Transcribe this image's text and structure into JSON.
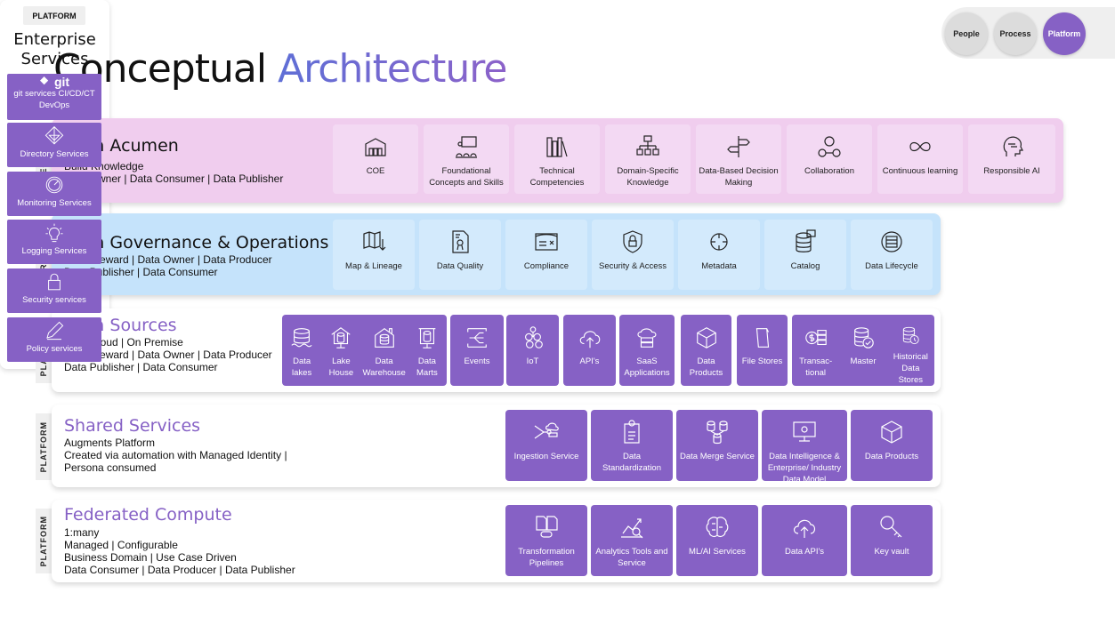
{
  "title": {
    "part1": "Conceptual",
    "part2": "Architecture"
  },
  "toggle": [
    {
      "label": "People",
      "active": false
    },
    {
      "label": "Process",
      "active": false
    },
    {
      "label": "Platform",
      "active": true
    }
  ],
  "colors": {
    "accent": "#8661c5",
    "people_band": "#f0cdee",
    "people_tile": "#f3d9f3",
    "process_band": "#c5e3fb",
    "process_tile": "#d3eafc"
  },
  "rows": [
    {
      "side": "PEOPLE",
      "title": "Data Acumen",
      "sub": [
        "Build Knowledge",
        "Data Owner | Data Consumer | Data Publisher"
      ],
      "tiles": [
        {
          "label": "COE",
          "icon": "building-icon"
        },
        {
          "label": "Foundational Concepts and Skills",
          "icon": "classroom-icon"
        },
        {
          "label": "Technical Competencies",
          "icon": "books-icon"
        },
        {
          "label": "Domain-Specific Knowledge",
          "icon": "hierarchy-icon"
        },
        {
          "label": "Data-Based Decision Making",
          "icon": "signpost-icon"
        },
        {
          "label": "Collaboration",
          "icon": "people-network-icon"
        },
        {
          "label": "Continuous learning",
          "icon": "infinity-icon"
        },
        {
          "label": "Responsible AI",
          "icon": "head-brain-icon"
        }
      ]
    },
    {
      "side": "PROCESS",
      "title": "Data Governance & Operations",
      "sub": [
        "Data Steward | Data Owner | Data Producer",
        "Data Publisher | Data Consumer"
      ],
      "tiles": [
        {
          "label": "Map & Lineage",
          "icon": "map-icon"
        },
        {
          "label": "Data Quality",
          "icon": "certificate-icon"
        },
        {
          "label": "Compliance",
          "icon": "compliance-icon"
        },
        {
          "label": "Security & Access",
          "icon": "shield-lock-icon"
        },
        {
          "label": "Metadata",
          "icon": "metadata-icon"
        },
        {
          "label": "Catalog",
          "icon": "catalog-icon"
        },
        {
          "label": "Data Lifecycle",
          "icon": "lifecycle-icon"
        }
      ]
    },
    {
      "side": "PLATFORM",
      "title": "Data Sources",
      "sub": [
        "Multi-Cloud | On Premise",
        "Data Steward | Data Owner | Data Producer",
        "Data Publisher | Data Consumer"
      ],
      "groups": [
        [
          {
            "label": "Data lakes",
            "icon": "database-lake-icon"
          },
          {
            "label": "Lake House",
            "icon": "database-house-icon"
          },
          {
            "label": "Data Warehouse",
            "icon": "warehouse-icon"
          },
          {
            "label": "Data Marts",
            "icon": "data-mart-icon"
          }
        ],
        [
          {
            "label": "Events",
            "icon": "events-icon"
          }
        ],
        [
          {
            "label": "IoT",
            "icon": "iot-icon"
          }
        ],
        [
          {
            "label": "API's",
            "icon": "cloud-upload-icon"
          }
        ],
        [
          {
            "label": "SaaS Applications",
            "icon": "saas-icon"
          }
        ],
        [
          {
            "label": "Data Products",
            "icon": "cube-icon"
          }
        ],
        [
          {
            "label": "File Stores",
            "icon": "file-icon"
          }
        ],
        [
          {
            "label": "Transac-tional",
            "icon": "transaction-icon"
          },
          {
            "label": "Master",
            "icon": "database-check-icon"
          },
          {
            "label": "Historical Data Stores",
            "icon": "database-clock-icon"
          }
        ]
      ]
    },
    {
      "side": "PLATFORM",
      "title": "Shared Services",
      "sub": [
        "Augments Platform",
        "Created via automation with Managed Identity |",
        "Persona consumed"
      ],
      "tiles": [
        {
          "label": "Ingestion Service",
          "icon": "ingestion-icon"
        },
        {
          "label": "Data Standardization",
          "icon": "document-gear-icon"
        },
        {
          "label": "Data Merge Service",
          "icon": "database-merge-icon"
        },
        {
          "label": "Data Intelligence & Enterprise/ Industry Data Model",
          "icon": "monitor-gear-icon"
        },
        {
          "label": "Data Products",
          "icon": "cube-icon"
        }
      ]
    },
    {
      "side": "PLATFORM",
      "title": "Federated Compute",
      "sub": [
        "1:many",
        "Managed | Configurable",
        "Business Domain | Use Case Driven",
        "Data Consumer | Data Producer | Data Publisher"
      ],
      "tiles": [
        {
          "label": "Transformation Pipelines",
          "icon": "pipeline-icon"
        },
        {
          "label": "Analytics Tools and Service",
          "icon": "analytics-icon"
        },
        {
          "label": "ML/AI Services",
          "icon": "brain-icon"
        },
        {
          "label": "Data API's",
          "icon": "cloud-upload-icon"
        },
        {
          "label": "Key vault",
          "icon": "key-icon"
        }
      ]
    }
  ],
  "enterprise": {
    "badge": "PLATFORM",
    "title": "Enterprise Services",
    "tiles": [
      {
        "label": "git services CI/CD/CT DevOps",
        "logo": "git",
        "icon": "git-icon"
      },
      {
        "label": "Directory Services",
        "icon": "directory-icon"
      },
      {
        "label": "Monitoring Services",
        "icon": "gauge-icon"
      },
      {
        "label": "Logging Services",
        "icon": "lightbulb-icon"
      },
      {
        "label": "Security services",
        "icon": "lock-icon"
      },
      {
        "label": "Policy services",
        "icon": "pencil-icon"
      }
    ]
  }
}
